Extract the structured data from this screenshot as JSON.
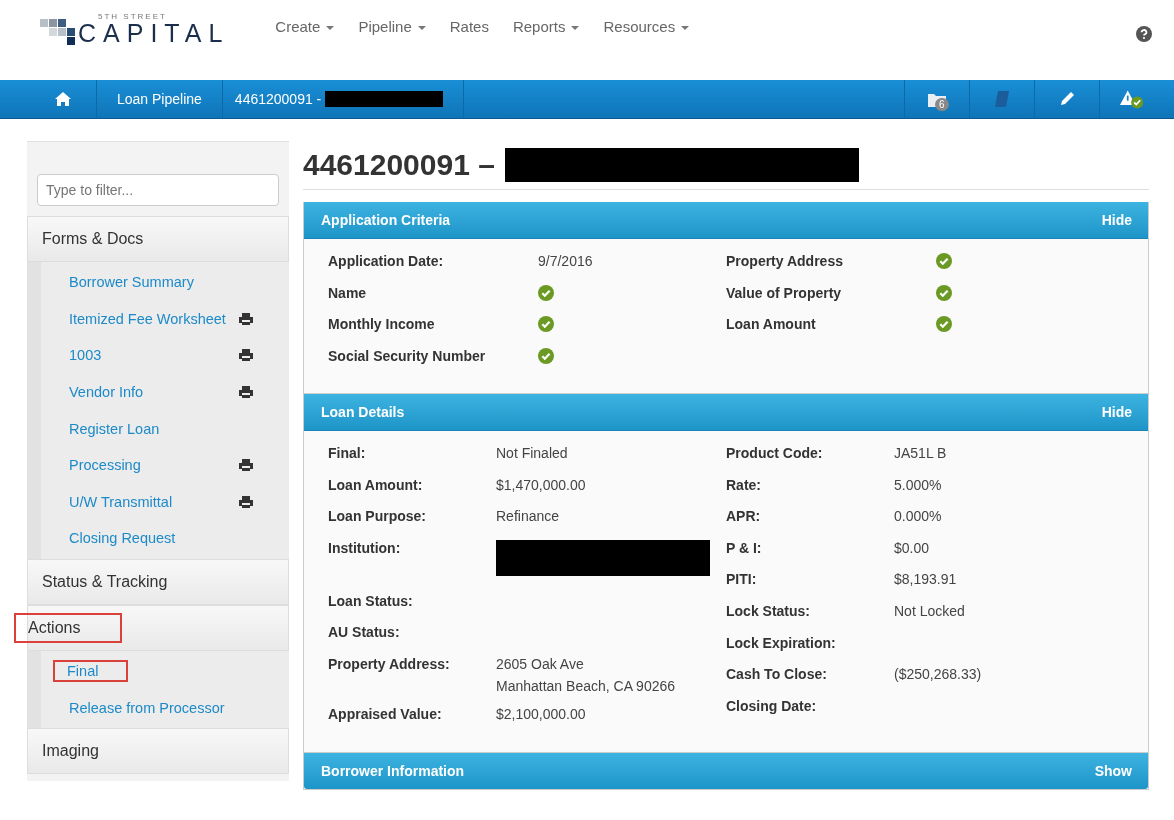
{
  "logo": {
    "top": "5TH STREET",
    "main": "CAPITAL"
  },
  "menu": [
    {
      "label": "Create",
      "dropdown": true
    },
    {
      "label": "Pipeline",
      "dropdown": true
    },
    {
      "label": "Rates",
      "dropdown": false
    },
    {
      "label": "Reports",
      "dropdown": true
    },
    {
      "label": "Resources",
      "dropdown": true
    }
  ],
  "breadcrumb": {
    "pipeline": "Loan Pipeline",
    "loan": "4461200091 -",
    "loan_redacted": true
  },
  "toolbar": {
    "folder_badge": "6"
  },
  "sidebar": {
    "filter_placeholder": "Type to filter...",
    "sections": [
      {
        "title": "Forms & Docs",
        "highlighted": false,
        "items": [
          {
            "label": "Borrower Summary",
            "print": false,
            "highlighted": false
          },
          {
            "label": "Itemized Fee Worksheet",
            "print": true,
            "highlighted": false
          },
          {
            "label": "1003",
            "print": true,
            "highlighted": false
          },
          {
            "label": "Vendor Info",
            "print": true,
            "highlighted": false
          },
          {
            "label": "Register Loan",
            "print": false,
            "highlighted": false
          },
          {
            "label": "Processing",
            "print": true,
            "highlighted": false
          },
          {
            "label": "U/W Transmittal",
            "print": true,
            "highlighted": false
          },
          {
            "label": "Closing Request",
            "print": false,
            "highlighted": false
          }
        ]
      },
      {
        "title": "Status & Tracking",
        "highlighted": false
      },
      {
        "title": "Actions",
        "highlighted": true,
        "items": [
          {
            "label": "Final",
            "print": false,
            "highlighted": true
          },
          {
            "label": "Release from Processor",
            "print": false,
            "highlighted": false
          }
        ]
      },
      {
        "title": "Imaging",
        "highlighted": false
      }
    ]
  },
  "page_title": {
    "text": "4461200091 –",
    "redacted": true
  },
  "panels": [
    {
      "title": "Application Criteria",
      "toggle": "Hide",
      "expanded": true,
      "columns": [
        [
          {
            "label": "Application Date:",
            "kind": "text",
            "value": "9/7/2016"
          },
          {
            "label": "Name",
            "kind": "check"
          },
          {
            "label": "Monthly Income",
            "kind": "check"
          },
          {
            "label": "Social Security Number",
            "kind": "check"
          }
        ],
        [
          {
            "label": "Property Address",
            "kind": "check"
          },
          {
            "label": "Value of Property",
            "kind": "check"
          },
          {
            "label": "Loan Amount",
            "kind": "check"
          }
        ]
      ]
    },
    {
      "title": "Loan Details",
      "toggle": "Hide",
      "expanded": true,
      "columns": [
        [
          {
            "label": "Final:",
            "kind": "text",
            "value": "Not Finaled"
          },
          {
            "label": "Loan Amount:",
            "kind": "text",
            "value": "$1,470,000.00"
          },
          {
            "label": "Loan Purpose:",
            "kind": "text",
            "value": "Refinance"
          },
          {
            "label": "Institution:",
            "kind": "redacted"
          },
          {
            "label": "Loan Status:",
            "kind": "text"
          },
          {
            "label": "AU Status:",
            "kind": "text"
          },
          {
            "label": "Property Address:",
            "kind": "lines",
            "lines": [
              "2605 Oak Ave",
              "Manhattan Beach, CA 90266"
            ]
          },
          {
            "label": "Appraised Value:",
            "kind": "text",
            "value": "$2,100,000.00"
          }
        ],
        [
          {
            "label": "Product Code:",
            "kind": "text",
            "value": "JA51L B"
          },
          {
            "label": "Rate:",
            "kind": "text",
            "value": "5.000%"
          },
          {
            "label": "APR:",
            "kind": "text",
            "value": "0.000%"
          },
          {
            "label": "P & I:",
            "kind": "text",
            "value": "$0.00"
          },
          {
            "label": "PITI:",
            "kind": "text",
            "value": "$8,193.91"
          },
          {
            "label": "Lock Status:",
            "kind": "text",
            "value": "Not Locked"
          },
          {
            "label": "Lock Expiration:",
            "kind": "text"
          },
          {
            "label": "Cash To Close:",
            "kind": "text",
            "value": "($250,268.33)"
          },
          {
            "label": "Closing Date:",
            "kind": "text"
          }
        ]
      ]
    },
    {
      "title": "Borrower Information",
      "toggle": "Show",
      "expanded": false
    }
  ]
}
